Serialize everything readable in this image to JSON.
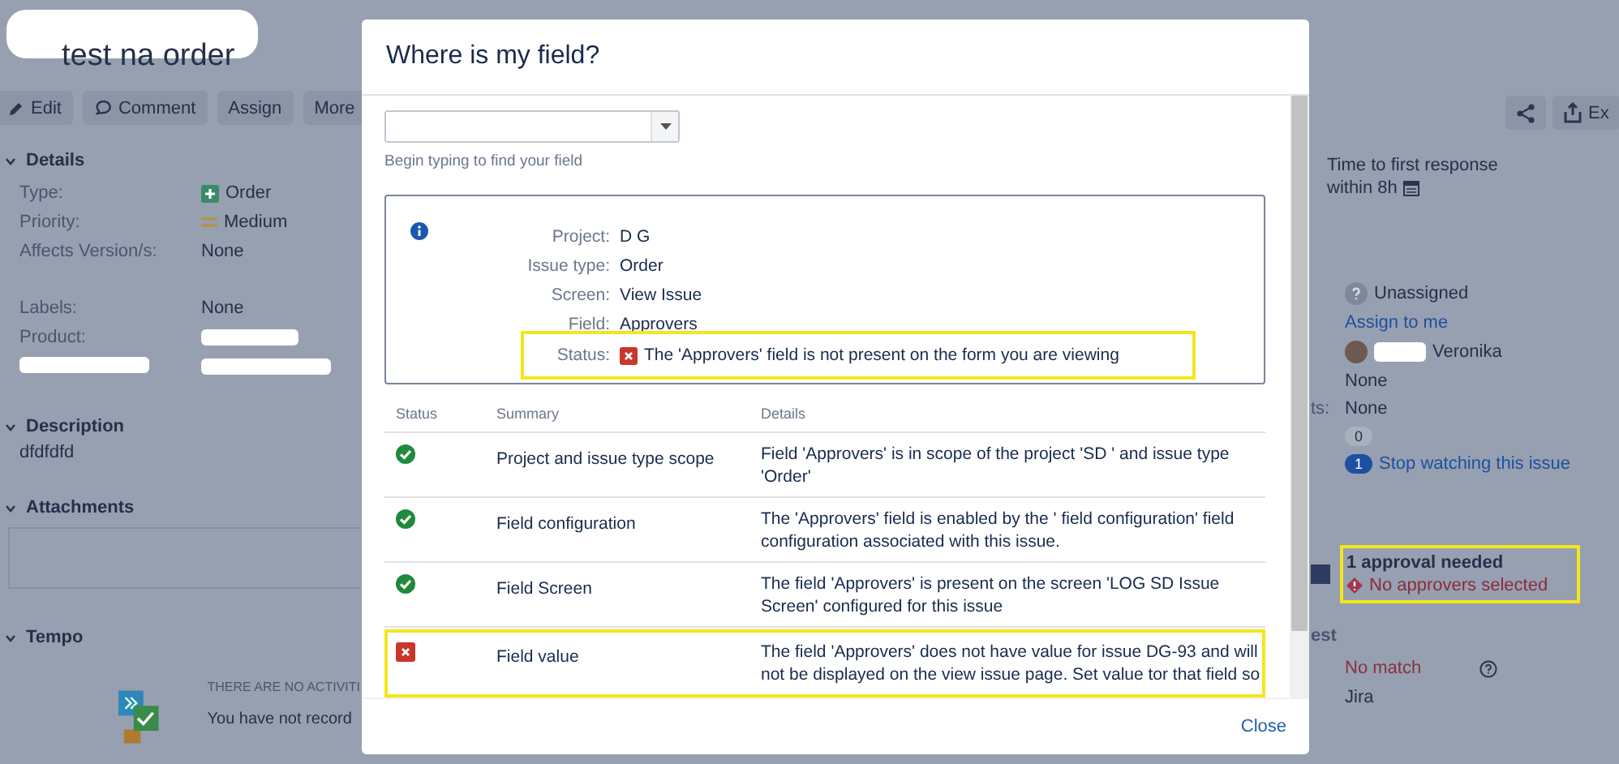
{
  "issue": {
    "title": "test na order",
    "actions": [
      {
        "label": "Edit"
      },
      {
        "label": "Comment"
      },
      {
        "label": "Assign"
      },
      {
        "label": "More"
      }
    ],
    "export_label": "Ex",
    "details": {
      "heading": "Details",
      "fields": [
        {
          "label": "Type:",
          "value": "Order"
        },
        {
          "label": "Priority:",
          "value": "Medium"
        },
        {
          "label": "Affects Version/s:",
          "value": "None"
        }
      ],
      "more_fields": [
        {
          "kind": "field",
          "label": "Labels:",
          "value": "None"
        },
        {
          "kind": "field",
          "label": "Product:"
        },
        {
          "kind": "redacted"
        }
      ]
    },
    "description": {
      "heading": "Description",
      "text": "dfdfdfd"
    },
    "attachments": {
      "heading": "Attachments"
    },
    "tempo": {
      "heading": "Tempo",
      "notice": "THERE ARE NO ACTIVITI",
      "message": "You have not record"
    },
    "side": {
      "sla_label": "Time to first response",
      "sla_value": "within 8h",
      "assignee": "Unassigned",
      "assign_link": "Assign to me",
      "reporter": "Veronika",
      "none_1": "None",
      "label_cut": "ts:",
      "none_2": "None",
      "votes": "0",
      "watchers": "1",
      "watch_link": "Stop watching this issue",
      "approval_title": "1 approval needed",
      "approval_warning": "No approvers selected",
      "section_cut": "est",
      "match": "No match",
      "source": "Jira"
    }
  },
  "dialog": {
    "title": "Where is my field?",
    "search": {
      "hint": "Begin typing to find your field"
    },
    "info": [
      {
        "label": "Project:",
        "value": "D G",
        "kind": "text",
        "highlighted": false
      },
      {
        "label": "Issue type:",
        "value": "Order",
        "kind": "text",
        "highlighted": false
      },
      {
        "label": "Screen:",
        "value": "View Issue",
        "kind": "text",
        "highlighted": false
      },
      {
        "label": "Field:",
        "value": "Approvers",
        "kind": "text",
        "highlighted": false
      },
      {
        "label": "Status:",
        "value": "The 'Approvers' field is not present on the form you are viewing",
        "kind": "status",
        "highlighted": true
      }
    ],
    "table": {
      "columns": [
        "Status",
        "Summary",
        "Details"
      ],
      "rows": [
        {
          "passed": true,
          "summary": "Project and issue type scope",
          "details": "Field 'Approvers' is in scope of the project 'SD ' and issue type 'Order'",
          "highlighted": false
        },
        {
          "passed": true,
          "summary": "Field configuration",
          "details": "The 'Approvers' field is enabled by the ' field configuration' field configuration associated with this issue.",
          "highlighted": false
        },
        {
          "passed": true,
          "summary": "Field Screen",
          "details": "The field 'Approvers' is present on the screen 'LOG SD Issue Screen' configured for this issue",
          "highlighted": false
        },
        {
          "passed": false,
          "summary": "Field value",
          "details": "The field 'Approvers' does not have value for issue DG-93 and will not be displayed on the view issue page. Set value tor that field so",
          "highlighted": true
        }
      ]
    },
    "close": "Close"
  }
}
